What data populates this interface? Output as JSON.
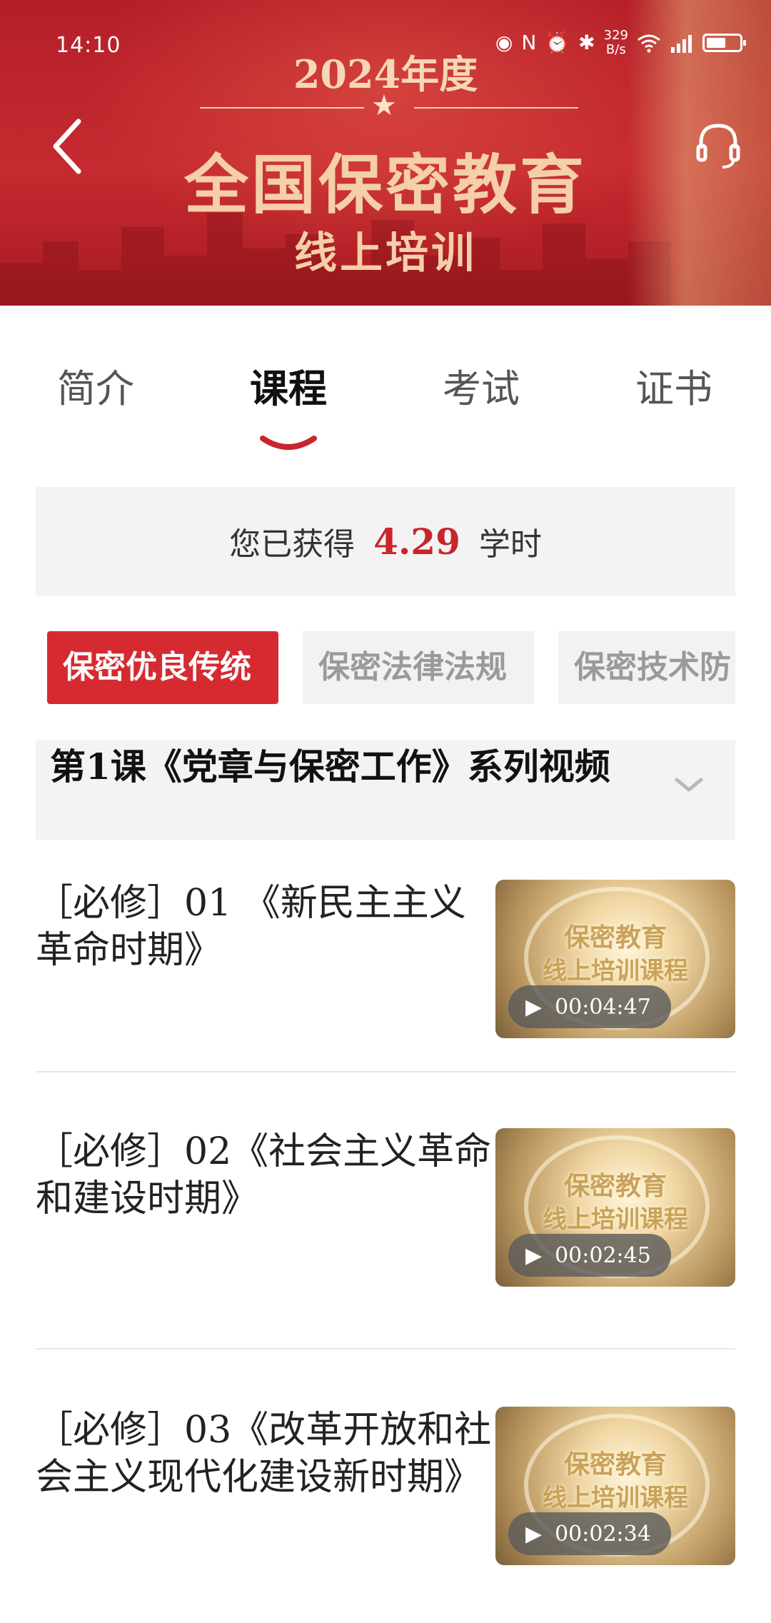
{
  "status_bar": {
    "time": "14:10",
    "net_speed_value": "329",
    "net_speed_unit": "B/s",
    "icons": [
      "eye-icon",
      "nfc-icon",
      "alarm-icon",
      "bluetooth-icon",
      "wifi-icon",
      "signal-5g-icon",
      "battery-icon"
    ]
  },
  "banner": {
    "year": "2024年度",
    "title": "全国保密教育",
    "subtitle": "线上培训",
    "back_icon": "chevron-left-icon",
    "support_icon": "headset-icon"
  },
  "tabs": [
    {
      "label": "简介",
      "active": false
    },
    {
      "label": "课程",
      "active": true
    },
    {
      "label": "考试",
      "active": false
    },
    {
      "label": "证书",
      "active": false
    }
  ],
  "hours": {
    "prefix": "您已获得",
    "value": "4.29",
    "suffix": "学时"
  },
  "categories": [
    {
      "label": "保密优良传统",
      "active": true
    },
    {
      "label": "保密法律法规",
      "active": false
    },
    {
      "label": "保密技术防",
      "active": false
    }
  ],
  "lesson": {
    "title": "第1课《党章与保密工作》系列视频"
  },
  "videos": [
    {
      "title": "［必修］01 《新民主主义革命时期》",
      "thumb_line1": "保密教育",
      "thumb_line2": "线上培训课程",
      "duration": "00:04:47"
    },
    {
      "title": "［必修］02《社会主义革命和建设时期》",
      "thumb_line1": "保密教育",
      "thumb_line2": "线上培训课程",
      "duration": "00:02:45"
    },
    {
      "title": "［必修］03《改革开放和社会主义现代化建设新时期》",
      "thumb_line1": "保密教育",
      "thumb_line2": "线上培训课程",
      "duration": "00:02:34"
    }
  ],
  "colors": {
    "brand_red": "#d62a31",
    "hours_value": "#c8262c",
    "banner_red": "#c52a30",
    "chip_inactive_bg": "#f2f2f2"
  }
}
